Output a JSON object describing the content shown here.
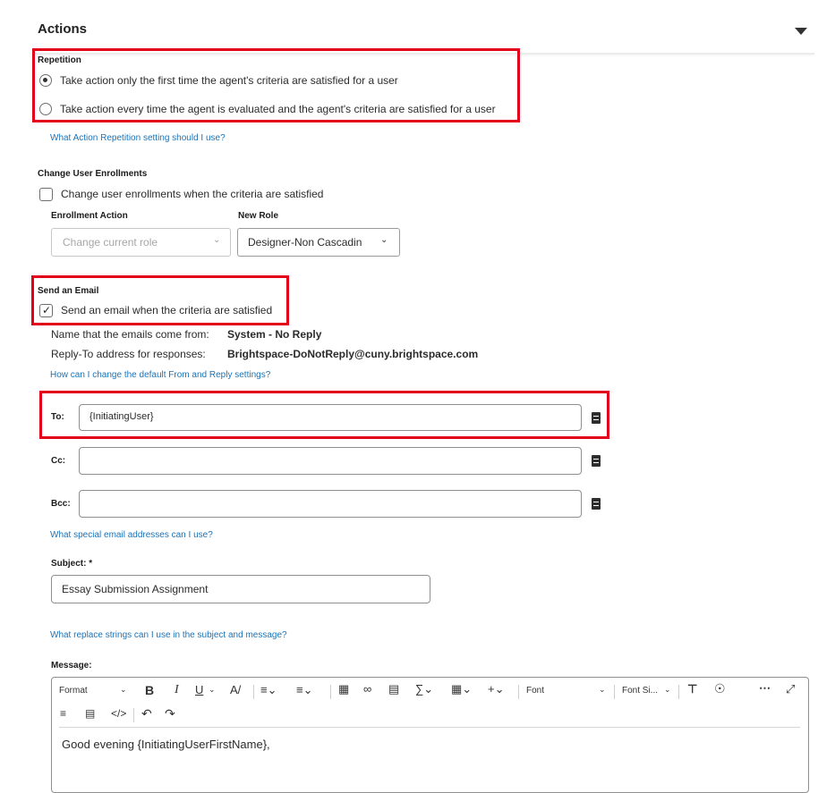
{
  "header": {
    "title": "Actions",
    "caret_icon": "caret-down-icon"
  },
  "repetition": {
    "label": "Repetition",
    "options": [
      {
        "label": "Take action only the first time the agent's criteria are satisfied for a user",
        "selected": true
      },
      {
        "label": "Take action every time the agent is evaluated and the agent's criteria are satisfied for a user",
        "selected": false
      }
    ],
    "help_link": "What Action Repetition setting should I use?"
  },
  "enrollments": {
    "label": "Change User Enrollments",
    "checkbox_label": "Change user enrollments when the criteria are satisfied",
    "checked": false,
    "enrollment_action_label": "Enrollment Action",
    "enrollment_action_value": "Change current role",
    "new_role_label": "New Role",
    "new_role_value": "Designer-Non Cascadin"
  },
  "email": {
    "label": "Send an Email",
    "checkbox_label": "Send an email when the criteria are satisfied",
    "checked": true,
    "from_name_label": "Name that the emails come from:",
    "from_name_value": "System - No Reply",
    "reply_to_label": "Reply-To address for responses:",
    "reply_to_value": "Brightspace-DoNotReply@cuny.brightspace.com",
    "defaults_link": "How can I change the default From and Reply settings?",
    "to_label": "To:",
    "to_value": "{InitiatingUser}",
    "cc_label": "Cc:",
    "cc_value": "",
    "bcc_label": "Bcc:",
    "bcc_value": "",
    "special_link": "What special email addresses can I use?",
    "subject_label": "Subject: *",
    "subject_value": "Essay Submission Assignment",
    "replace_link": "What replace strings can I use in the subject and message?",
    "message_label": "Message:",
    "message_text": "Good evening {InitiatingUserFirstName},"
  },
  "toolbar": {
    "format_label": "Format",
    "font_label": "Font",
    "font_size_label": "Font Si...",
    "icons": [
      "bold-icon",
      "italic-icon",
      "underline-icon",
      "text-color-icon",
      "align-icon",
      "list-icon",
      "insert-stuff-icon",
      "link-icon",
      "media-icon",
      "equation-icon",
      "table-icon",
      "insert-icon",
      "format-painter-icon",
      "accessibility-icon",
      "more-icon",
      "fullscreen-icon",
      "word-count-icon",
      "preview-icon",
      "source-code-icon",
      "undo-icon",
      "redo-icon"
    ]
  },
  "colors": {
    "highlight": "#e2001a",
    "link": "#1a73b8"
  }
}
